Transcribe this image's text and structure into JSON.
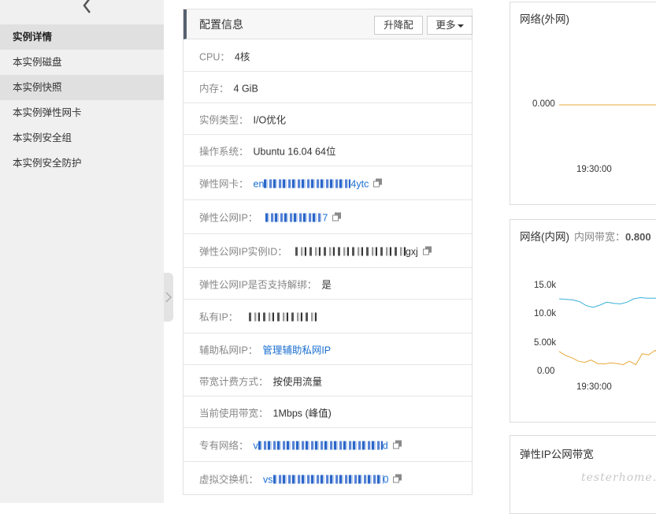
{
  "sidebar": {
    "items": [
      {
        "label": "实例详情"
      },
      {
        "label": "本实例磁盘"
      },
      {
        "label": "本实例快照"
      },
      {
        "label": "本实例弹性网卡"
      },
      {
        "label": "本实例安全组"
      },
      {
        "label": "本实例安全防护"
      }
    ]
  },
  "config": {
    "title": "配置信息",
    "upgrade_label": "升降配",
    "more_label": "更多",
    "rows": [
      {
        "label": "CPU：",
        "value": "4核"
      },
      {
        "label": "内存：",
        "value": "4 GiB"
      },
      {
        "label": "实例类型：",
        "value": "I/O优化"
      },
      {
        "label": "操作系统：",
        "value": "Ubuntu 16.04 64位"
      },
      {
        "label": "弹性网卡：",
        "value_prefix": "en",
        "value_suffix": "4ytc"
      },
      {
        "label": "弹性公网IP：",
        "value_suffix": "7"
      },
      {
        "label": "弹性公网IP实例ID：",
        "value_suffix": "gxj"
      },
      {
        "label": "弹性公网IP是否支持解绑：",
        "value": "是"
      },
      {
        "label": "私有IP：",
        "value": ""
      },
      {
        "label": "辅助私网IP：",
        "link": "管理辅助私网IP"
      },
      {
        "label": "带宽计费方式：",
        "value": "按使用流量"
      },
      {
        "label": "当前使用带宽：",
        "value": "1Mbps (峰值)"
      },
      {
        "label": "专有网络：",
        "value_prefix": "v",
        "value_suffix": "d"
      },
      {
        "label": "虚拟交换机：",
        "value_prefix": "vs",
        "value_suffix": "0"
      }
    ]
  },
  "charts": [
    {
      "title": "网络(外网)",
      "chart_data": {
        "type": "line",
        "x_ticks": [
          "19:30:00"
        ],
        "y_ticks": [
          "0.000"
        ],
        "series": [
          {
            "values": [
              0,
              0,
              0,
              0,
              0,
              0,
              0,
              0
            ],
            "color": "#e8a93a"
          }
        ]
      }
    },
    {
      "title": "网络(内网)",
      "subtitle_label": "内网带宽：",
      "subtitle_value": "0.800",
      "chart_data": {
        "type": "line",
        "x_ticks": [
          "19:30:00"
        ],
        "y_ticks": [
          "15.0k",
          "10.0k",
          "5.00k",
          "0.00"
        ],
        "ylim": [
          0,
          15000
        ],
        "series": [
          {
            "values": [
              12800,
              12700,
              12600,
              12300,
              11600,
              11300,
              11700,
              12200,
              12000,
              11900,
              12200,
              12800,
              13000,
              12900,
              12900,
              13000,
              12700
            ],
            "color": "#3ab0d8"
          },
          {
            "values": [
              3600,
              2900,
              2500,
              1900,
              1700,
              2100,
              1500,
              1400,
              1600,
              1500,
              1300,
              1900,
              1300,
              3200,
              3000,
              3800,
              2600,
              3400
            ],
            "color": "#e8a93a"
          }
        ]
      }
    },
    {
      "title": "弹性IP公网带宽"
    }
  ],
  "watermark": "testerhome.com",
  "colors": {
    "link": "#1a6fd1",
    "sidebar_bg": "#f0f0f0",
    "active_bg": "#e0e0e0",
    "header_accent": "#56616f"
  }
}
